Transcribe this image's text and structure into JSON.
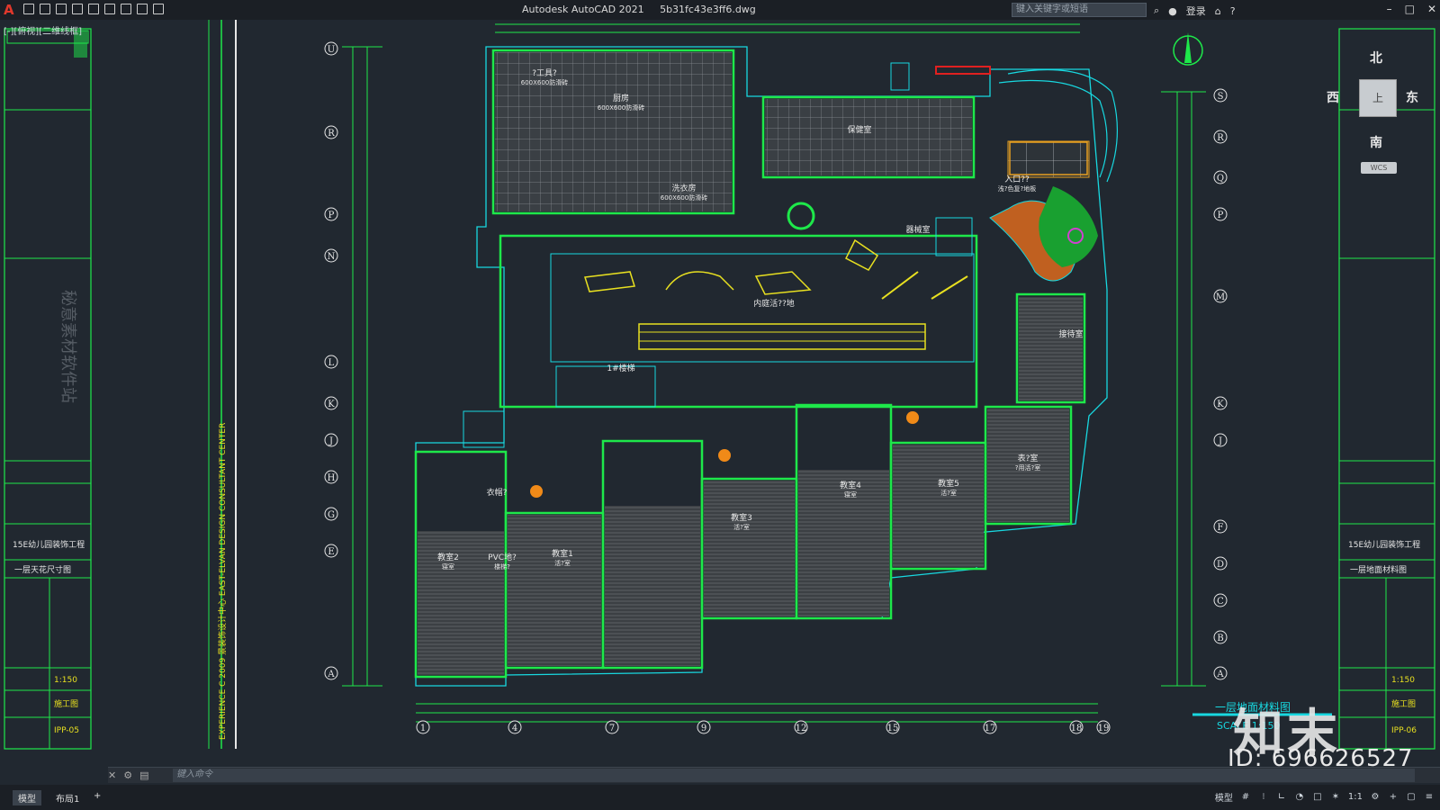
{
  "titlebar": {
    "app_title": "Autodesk AutoCAD 2021",
    "file_name": "5b31fc43e3ff6.dwg",
    "search_placeholder": "键入关键字或短语",
    "sign_in": "登录"
  },
  "viewport": {
    "label": "[-][俯视][二维线框]"
  },
  "viewcube": {
    "north": "北",
    "south": "南",
    "east": "东",
    "west": "西",
    "face": "上",
    "wcs": "WCS"
  },
  "grid_left": [
    "U",
    "R",
    "P",
    "N",
    "L",
    "K",
    "J",
    "H",
    "G",
    "E",
    "A"
  ],
  "grid_right": [
    "S",
    "R",
    "Q",
    "P",
    "M",
    "K",
    "J",
    "F",
    "D",
    "C",
    "B",
    "A"
  ],
  "grid_bottom": [
    "1",
    "4",
    "7",
    "9",
    "12",
    "15",
    "17",
    "18",
    "19"
  ],
  "rooms": [
    {
      "name": "厨房",
      "sub": "600X600防滑砖"
    },
    {
      "name": "?工具?",
      "sub": "600X600防滑砖"
    },
    {
      "name": "洗衣房",
      "sub": "600X600防滑砖"
    },
    {
      "name": "保健室",
      "sub": ""
    },
    {
      "name": "内庭活??地",
      "sub": ""
    },
    {
      "name": "入口??",
      "sub": "浅?色复?地板"
    },
    {
      "name": "接待室",
      "sub": ""
    },
    {
      "name": "器械室",
      "sub": ""
    },
    {
      "name": "1#楼梯",
      "sub": ""
    },
    {
      "name": "教室1",
      "sub": "活?室"
    },
    {
      "name": "教室2",
      "sub": "寝室"
    },
    {
      "name": "教室3",
      "sub": "活?室"
    },
    {
      "name": "教室4",
      "sub": "寝室"
    },
    {
      "name": "教室5",
      "sub": "活?室"
    },
    {
      "name": "表?室",
      "sub": "?用活?室"
    },
    {
      "name": "衣帽?",
      "sub": ""
    },
    {
      "name": "PVC地?",
      "sub": "楼梯?"
    }
  ],
  "left_panel": {
    "project": "15E幼儿园装饰工程",
    "sheet": "一层天花尺寸图",
    "scale": "1:150",
    "stage": "施工图",
    "number": "IPP-05",
    "vertical_text": "EXPERIENCE C 2009 景装饰设计中心 EAST-ELVAN DESIGN CONSULTANT CENTER"
  },
  "right_panel": {
    "project": "15E幼儿园装饰工程",
    "sheet": "一层地面材料图",
    "scale": "1:150",
    "stage": "施工图",
    "number": "IPP-06"
  },
  "drawing_title": {
    "name": "一层地面材料图",
    "scale": "SCALE  1:150"
  },
  "left_watermark": "秘意素材软件站",
  "statusbar": {
    "model_tab": "模型",
    "layout_tab": "布局1",
    "add_tab": "+",
    "model_label": "模型",
    "scale": "1:1"
  },
  "cmd": {
    "placeholder": "键入命令"
  },
  "watermark": {
    "logo": "知末",
    "id": "ID: 696626527"
  },
  "colors": {
    "bg": "#212830",
    "green": "#1ee84a",
    "cyan": "#18d8e0",
    "yellow": "#e8e020",
    "white": "#e6e6e6",
    "orange": "#f08a18",
    "red": "#e02020"
  }
}
